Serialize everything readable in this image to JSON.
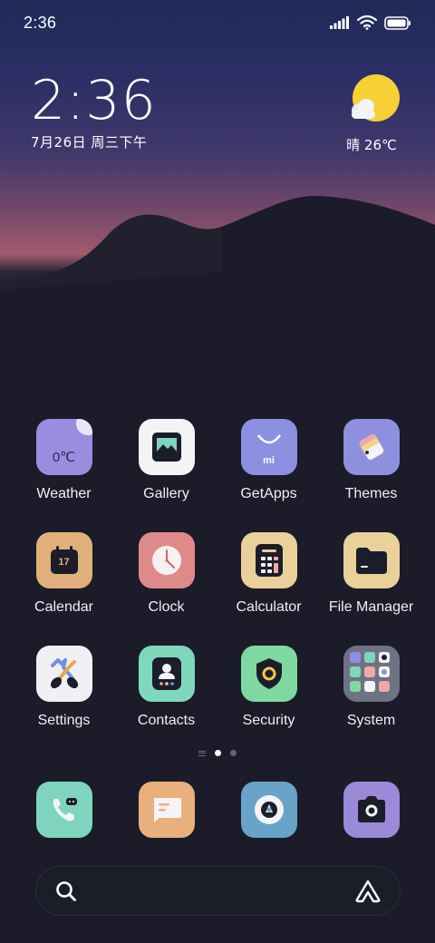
{
  "status_bar": {
    "time": "2:36",
    "icons": [
      "signal-icon",
      "wifi-icon",
      "battery-icon"
    ]
  },
  "clock_widget": {
    "time": "2:36",
    "date": "7月26日 周三下午"
  },
  "weather_widget": {
    "icon": "sun-cloud-icon",
    "text": "晴 26℃"
  },
  "apps": [
    {
      "label": "Weather",
      "icon": "weather-icon",
      "color": "#9b8ce0",
      "icon_text": "0℃"
    },
    {
      "label": "Gallery",
      "icon": "gallery-icon",
      "color": "#f4f4f7"
    },
    {
      "label": "GetApps",
      "icon": "getapps-icon",
      "color": "#8d8fe0",
      "icon_text": "mi"
    },
    {
      "label": "Themes",
      "icon": "themes-icon",
      "color": "#8f8fe0"
    },
    {
      "label": "Calendar",
      "icon": "calendar-icon",
      "color": "#e1b07a",
      "icon_text": "17"
    },
    {
      "label": "Clock",
      "icon": "clock-icon",
      "color": "#df8a8a"
    },
    {
      "label": "Calculator",
      "icon": "calculator-icon",
      "color": "#ead09a"
    },
    {
      "label": "File Manager",
      "icon": "folder-icon",
      "color": "#ead09a"
    },
    {
      "label": "Settings",
      "icon": "settings-icon",
      "color": "#f0f0f4"
    },
    {
      "label": "Contacts",
      "icon": "contacts-icon",
      "color": "#7fd8bd"
    },
    {
      "label": "Security",
      "icon": "security-icon",
      "color": "#7fd8a0"
    },
    {
      "label": "System",
      "icon": "system-folder-icon",
      "color": "#6f7282"
    }
  ],
  "page_indicator": {
    "pages": 2,
    "current": 1
  },
  "dock": [
    {
      "icon": "phone-icon",
      "color": "#7fd4bd"
    },
    {
      "icon": "messages-icon",
      "color": "#e8b07c"
    },
    {
      "icon": "browser-icon",
      "color": "#6aa3c8"
    },
    {
      "icon": "camera-icon",
      "color": "#9a8ad8"
    }
  ],
  "search_bar": {
    "left_icon": "search-icon",
    "right_icon": "assistant-icon"
  }
}
